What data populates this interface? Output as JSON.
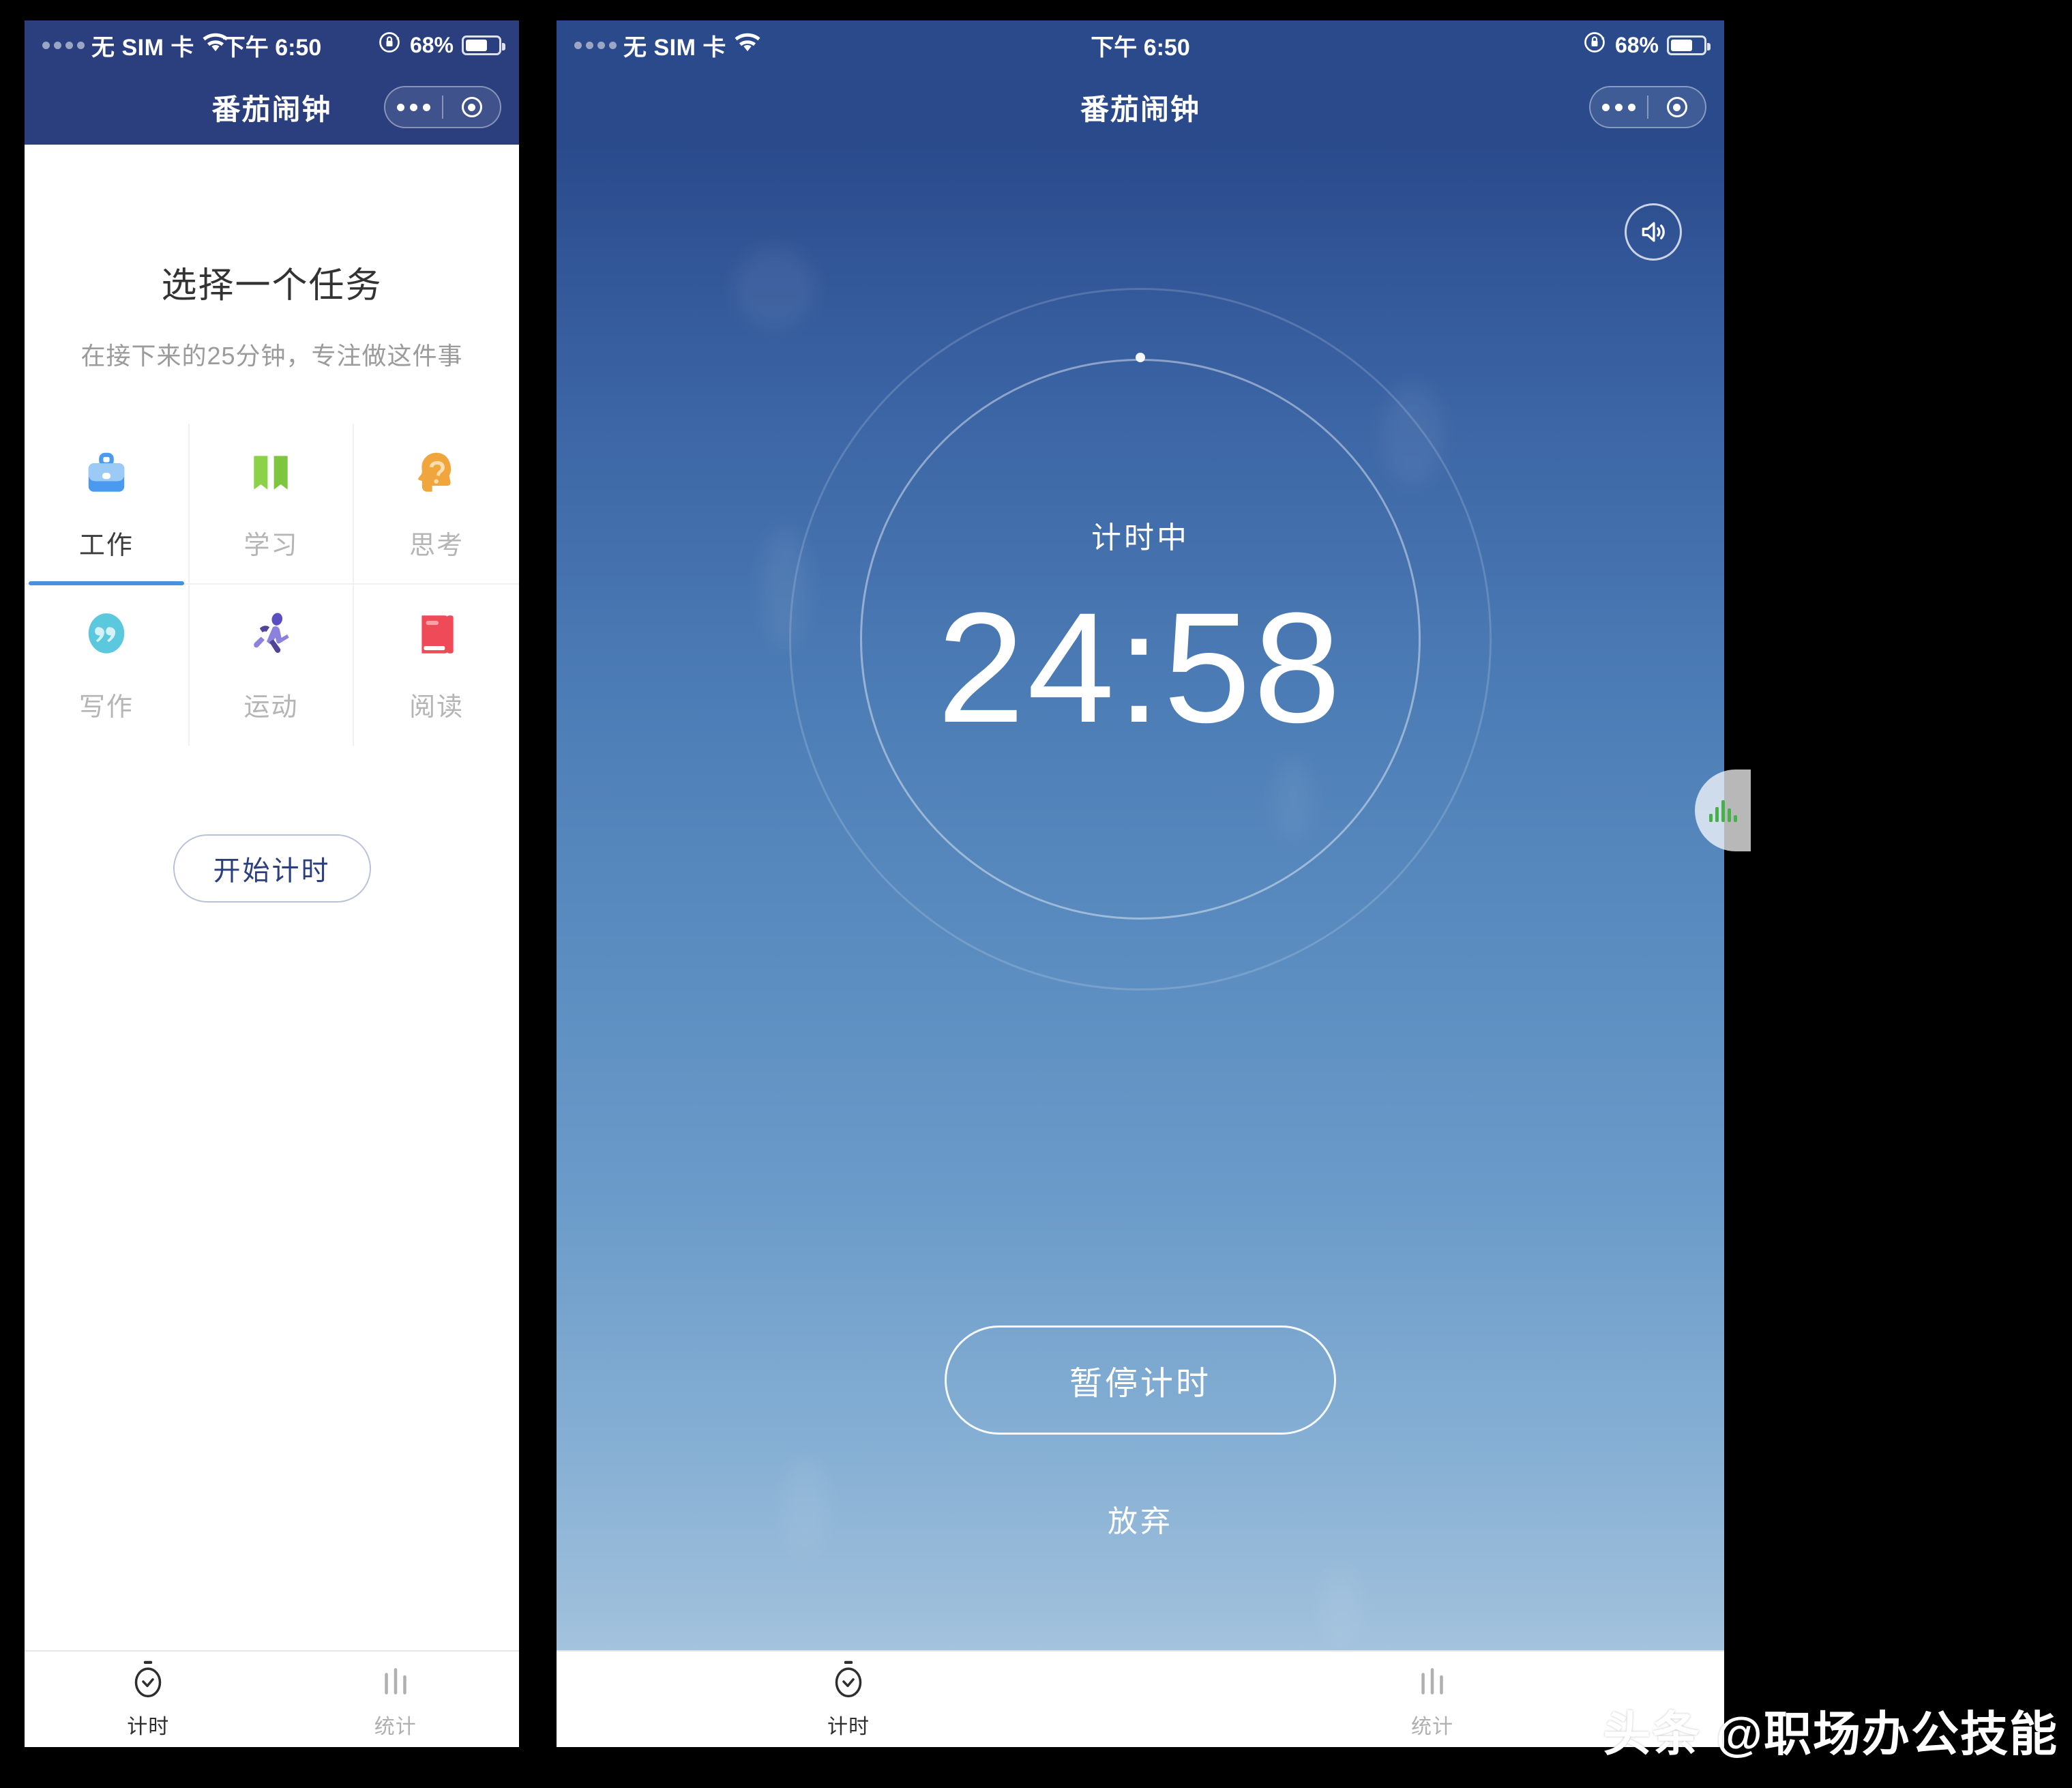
{
  "status_bar": {
    "carrier": "无 SIM 卡",
    "wifi_icon": "wifi-icon",
    "time": "下午 6:50",
    "rotation_lock_icon": "rotation-lock-icon",
    "battery_text": "68%",
    "battery_level": 68,
    "battery_icon": "battery-icon"
  },
  "nav": {
    "title": "番茄闹钟",
    "more_icon": "more-dots-icon",
    "target_icon": "target-circle-icon"
  },
  "colors": {
    "header_navy": "#2b3f7e",
    "header_blue": "#2a4a8c",
    "accent_blue": "#4a90e2",
    "start_button_text": "#2b3f7e"
  },
  "left_screen": {
    "page_title": "选择一个任务",
    "page_subtitle": "在接下来的25分钟，专注做这件事",
    "tasks": [
      {
        "label": "工作",
        "icon": "briefcase-icon",
        "color": "#5aa7f2",
        "selected": true
      },
      {
        "label": "学习",
        "icon": "open-book-icon",
        "color": "#7ed321",
        "selected": false
      },
      {
        "label": "思考",
        "icon": "thinking-head-icon",
        "color": "#f0a63c",
        "selected": false
      },
      {
        "label": "写作",
        "icon": "quote-bubble-icon",
        "color": "#5bc8de",
        "selected": false
      },
      {
        "label": "运动",
        "icon": "running-person-icon",
        "color": "#7b6fd0",
        "selected": false
      },
      {
        "label": "阅读",
        "icon": "closed-book-icon",
        "color": "#ef4a58",
        "selected": false
      }
    ],
    "start_button": "开始计时",
    "tabs": [
      {
        "label": "计时",
        "icon": "stopwatch-icon",
        "active": true
      },
      {
        "label": "统计",
        "icon": "bar-chart-icon",
        "active": false
      }
    ]
  },
  "right_screen": {
    "speaker_icon": "speaker-on-icon",
    "timer_status": "计时中",
    "timer_value": "24:58",
    "timer_minutes": "24",
    "timer_seconds": "58",
    "pause_button": "暂停计时",
    "giveup_button": "放弃",
    "side_handle_icon": "audio-wave-icon",
    "tabs": [
      {
        "label": "计时",
        "icon": "stopwatch-icon",
        "active": true
      },
      {
        "label": "统计",
        "icon": "bar-chart-icon",
        "active": false
      }
    ]
  },
  "watermark": "头条 @职场办公技能"
}
